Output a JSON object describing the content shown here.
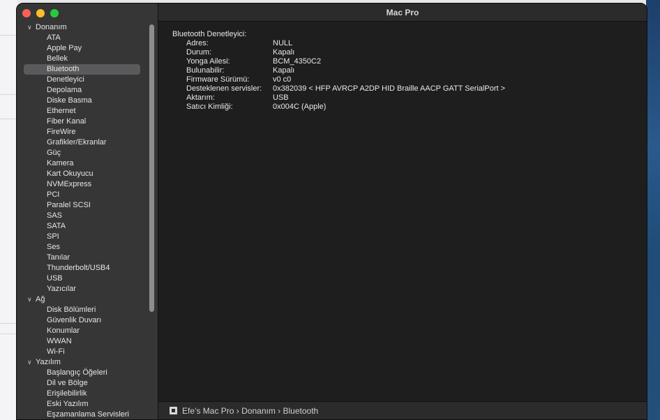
{
  "window": {
    "title": "Mac Pro"
  },
  "sidebar": {
    "selected": "Bluetooth",
    "rows": [
      {
        "type": "section",
        "label": "Donanım"
      },
      {
        "type": "item",
        "label": "ATA"
      },
      {
        "type": "item",
        "label": "Apple Pay"
      },
      {
        "type": "item",
        "label": "Bellek"
      },
      {
        "type": "item",
        "label": "Bluetooth",
        "selected": true
      },
      {
        "type": "item",
        "label": "Denetleyici"
      },
      {
        "type": "item",
        "label": "Depolama"
      },
      {
        "type": "item",
        "label": "Diske Basma"
      },
      {
        "type": "item",
        "label": "Ethernet"
      },
      {
        "type": "item",
        "label": "Fiber Kanal"
      },
      {
        "type": "item",
        "label": "FireWire"
      },
      {
        "type": "item",
        "label": "Grafikler/Ekranlar"
      },
      {
        "type": "item",
        "label": "Güç"
      },
      {
        "type": "item",
        "label": "Kamera"
      },
      {
        "type": "item",
        "label": "Kart Okuyucu"
      },
      {
        "type": "item",
        "label": "NVMExpress"
      },
      {
        "type": "item",
        "label": "PCI"
      },
      {
        "type": "item",
        "label": "Paralel SCSI"
      },
      {
        "type": "item",
        "label": "SAS"
      },
      {
        "type": "item",
        "label": "SATA"
      },
      {
        "type": "item",
        "label": "SPI"
      },
      {
        "type": "item",
        "label": "Ses"
      },
      {
        "type": "item",
        "label": "Tanılar"
      },
      {
        "type": "item",
        "label": "Thunderbolt/USB4"
      },
      {
        "type": "item",
        "label": "USB"
      },
      {
        "type": "item",
        "label": "Yazıcılar"
      },
      {
        "type": "section",
        "label": "Ağ"
      },
      {
        "type": "item",
        "label": "Disk Bölümleri"
      },
      {
        "type": "item",
        "label": "Güvenlik Duvarı"
      },
      {
        "type": "item",
        "label": "Konumlar"
      },
      {
        "type": "item",
        "label": "WWAN"
      },
      {
        "type": "item",
        "label": "Wi-Fi"
      },
      {
        "type": "section",
        "label": "Yazılım"
      },
      {
        "type": "item",
        "label": "Başlangıç Öğeleri"
      },
      {
        "type": "item",
        "label": "Dil ve Bölge"
      },
      {
        "type": "item",
        "label": "Erişilebilirlik"
      },
      {
        "type": "item",
        "label": "Eski Yazılım"
      },
      {
        "type": "item",
        "label": "Eşzamanlama Servisleri"
      }
    ]
  },
  "detail": {
    "heading": "Bluetooth Denetleyici:",
    "properties": [
      {
        "key": "Adres:",
        "value": "NULL"
      },
      {
        "key": "Durum:",
        "value": "Kapalı"
      },
      {
        "key": "Yonga Ailesi:",
        "value": "BCM_4350C2"
      },
      {
        "key": "Bulunabilir:",
        "value": "Kapalı"
      },
      {
        "key": "Firmware Sürümü:",
        "value": "v0 c0"
      },
      {
        "key": "Desteklenen servisler:",
        "value": "0x382039 < HFP AVRCP A2DP HID Braille AACP GATT SerialPort >"
      },
      {
        "key": "Aktarım:",
        "value": "USB"
      },
      {
        "key": "Satıcı Kimliği:",
        "value": "0x004C (Apple)"
      }
    ]
  },
  "statusbar": {
    "icon": "computer-icon",
    "path": "Efe’s Mac Pro › Donanım › Bluetooth"
  }
}
